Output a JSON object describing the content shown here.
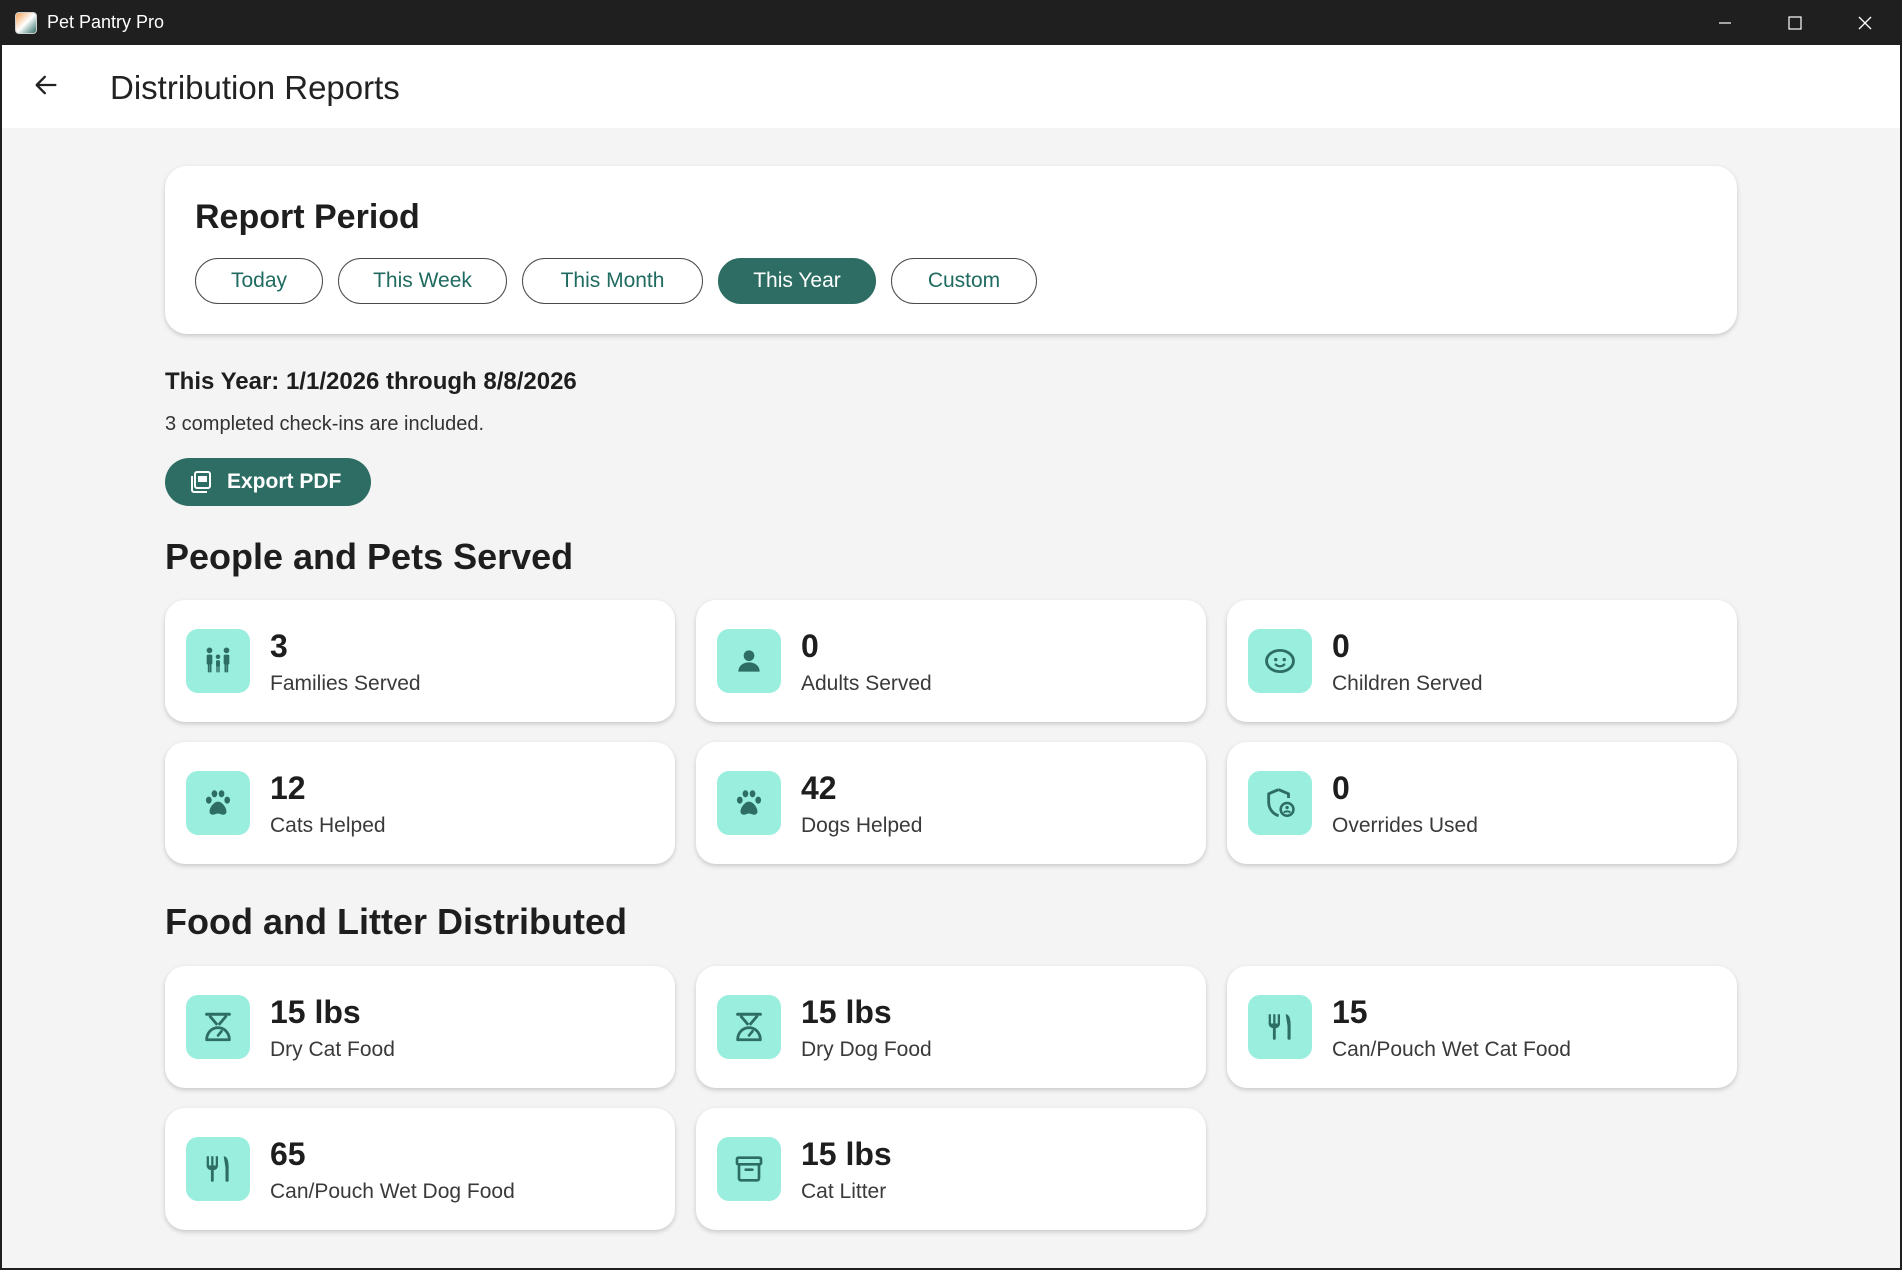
{
  "window": {
    "title": "Pet Pantry Pro",
    "icon": "app-logo"
  },
  "appbar": {
    "back_icon": "arrow-left-icon",
    "title": "Distribution Reports"
  },
  "report_period": {
    "heading": "Report Period",
    "options": [
      {
        "label": "Today",
        "selected": false
      },
      {
        "label": "This Week",
        "selected": false
      },
      {
        "label": "This Month",
        "selected": false
      },
      {
        "label": "This Year",
        "selected": true
      },
      {
        "label": "Custom",
        "selected": false
      }
    ]
  },
  "summary": {
    "range": "This Year: 1/1/2026 through 8/8/2026",
    "checkins": "3 completed check-ins are included."
  },
  "export": {
    "label": "Export PDF",
    "icon": "pdf-icon"
  },
  "people_section": {
    "title": "People and Pets Served",
    "stats": [
      {
        "value": "3",
        "label": "Families Served",
        "icon": "family-icon"
      },
      {
        "value": "0",
        "label": "Adults Served",
        "icon": "person-icon"
      },
      {
        "value": "0",
        "label": "Children Served",
        "icon": "child-face-icon"
      },
      {
        "value": "12",
        "label": "Cats Helped",
        "icon": "paw-icon"
      },
      {
        "value": "42",
        "label": "Dogs Helped",
        "icon": "paw-icon"
      },
      {
        "value": "0",
        "label": "Overrides Used",
        "icon": "shield-override-icon"
      }
    ]
  },
  "food_section": {
    "title": "Food and Litter Distributed",
    "stats": [
      {
        "value": "15 lbs",
        "label": "Dry Cat Food",
        "icon": "scale-icon"
      },
      {
        "value": "15 lbs",
        "label": "Dry Dog Food",
        "icon": "scale-icon"
      },
      {
        "value": "15",
        "label": "Can/Pouch Wet Cat Food",
        "icon": "utensils-icon"
      },
      {
        "value": "65",
        "label": "Can/Pouch Wet Dog Food",
        "icon": "utensils-icon"
      },
      {
        "value": "15 lbs",
        "label": "Cat Litter",
        "icon": "archive-box-icon"
      }
    ]
  },
  "colors": {
    "accent": "#2d6d63",
    "icon_tile": "#99eede",
    "background": "#f3f4f3"
  }
}
